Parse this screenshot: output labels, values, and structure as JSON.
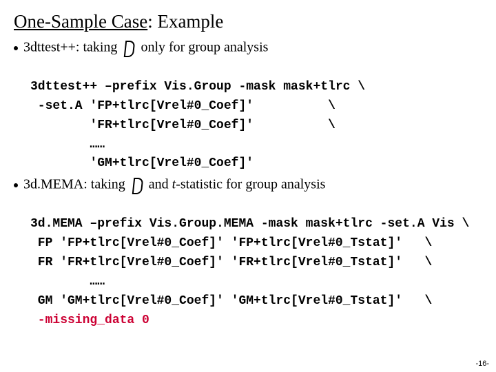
{
  "title": {
    "underlined": "One-Sample Case",
    "rest": ": Example"
  },
  "bullet1": {
    "prefix": "3dttest++: taking ",
    "suffix": "only for group analysis"
  },
  "code1": {
    "l1": "3dttest++ –prefix Vis.Group -mask mask+tlrc \\",
    "l2": " -set.A 'FP+tlrc[Vrel#0_Coef]'          \\",
    "l3": "        'FR+tlrc[Vrel#0_Coef]'          \\",
    "l4": "        ……",
    "l5": "        'GM+tlrc[Vrel#0_Coef]'"
  },
  "bullet2": {
    "prefix": "3d.MEMA: taking ",
    "mid": "and ",
    "tstat": "t",
    "suffix": "-statistic for group analysis"
  },
  "code2": {
    "l1": "3d.MEMA –prefix Vis.Group.MEMA -mask mask+tlrc -set.A Vis \\",
    "l2": " FP 'FP+tlrc[Vrel#0_Coef]' 'FP+tlrc[Vrel#0_Tstat]'   \\",
    "l3": " FR 'FR+tlrc[Vrel#0_Coef]' 'FR+tlrc[Vrel#0_Tstat]'   \\",
    "l4": "        ……",
    "l5": " GM 'GM+tlrc[Vrel#0_Coef]' 'GM+tlrc[Vrel#0_Tstat]'   \\",
    "l6_red": " -missing_data 0"
  },
  "page_number": "-16-"
}
